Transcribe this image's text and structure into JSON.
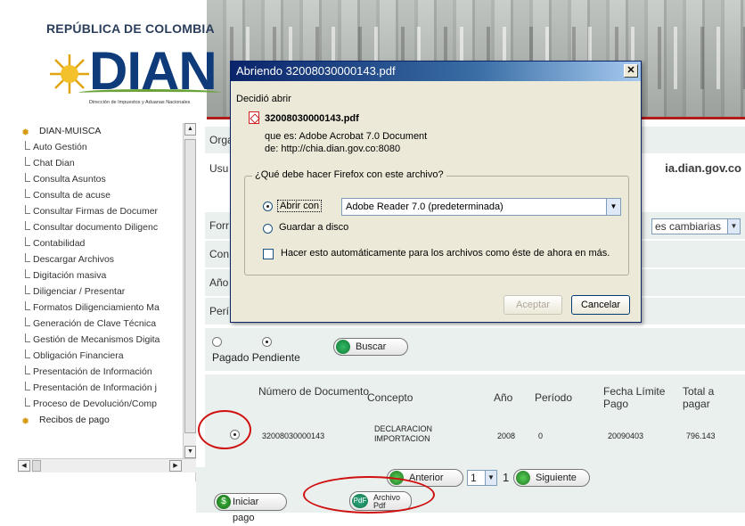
{
  "header": {
    "country": "REPÚBLICA DE COLOMBIA",
    "logo_text": "DIAN",
    "logo_subtitle": "Dirección de Impuestos y Aduanas Nacionales"
  },
  "sidebar": {
    "root": "DIAN-MUISCA",
    "items": [
      "Auto Gestión",
      "Chat Dian",
      "Consulta Asuntos",
      "Consulta de acuse",
      "Consultar Firmas de Documer",
      "Consultar documento Diligenc",
      "Contabilidad",
      "Descargar Archivos",
      "Digitación masiva",
      "Diligenciar / Presentar",
      "Formatos Diligenciamiento Ma",
      "Generación de Clave Técnica",
      "Gestión de Mecanismos Digita",
      "Obligación Financiera",
      "Presentación de Información",
      "Presentación de Información j",
      "Proceso de Devolución/Comp",
      "Recibos de pago"
    ]
  },
  "main": {
    "labels": [
      "Orga",
      "Usu",
      "Forr",
      "Con",
      "Año",
      "Perí"
    ],
    "domain_text": "ia.dian.gov.co",
    "select_value": "es cambiarias",
    "radio_labels": "Pagado Pendiente",
    "search_button": "Buscar",
    "table": {
      "headers": [
        "Número de Documento",
        "Concepto",
        "Año",
        "Período",
        "Fecha Límite Pago",
        "Total a pagar"
      ],
      "row": [
        "32008030000143",
        "DECLARACION IMPORTACION",
        "2008",
        "0",
        "20090403",
        "796.143"
      ]
    },
    "pager": {
      "prev": "Anterior",
      "page_value": "1",
      "page_total": "1",
      "next": "Siguiente"
    },
    "bottom": {
      "pay_button": "Iniciar pago",
      "pdf_button_line1": "Archivo",
      "pdf_button_line2": "Pdf",
      "pdf_icon": "PdF"
    }
  },
  "dialog": {
    "title": "Abriendo 32008030000143.pdf",
    "decided": "Decidió abrir",
    "filename": "32008030000143.pdf",
    "type_line": "que es:  Adobe Acrobat 7.0 Document",
    "from_line": "de:  http://chia.dian.gov.co:8080",
    "question": "¿Qué debe hacer Firefox con este archivo?",
    "open_with": "Abrir con",
    "app": "Adobe Reader 7.0 (predeterminada)",
    "save": "Guardar a disco",
    "auto": "Hacer esto automáticamente para los archivos como éste de ahora en más.",
    "accept": "Aceptar",
    "cancel": "Cancelar"
  },
  "colors": {
    "accent_red": "#d01010",
    "brand_blue": "#0f3b7a",
    "panel_bg": "#eaf0ee"
  }
}
